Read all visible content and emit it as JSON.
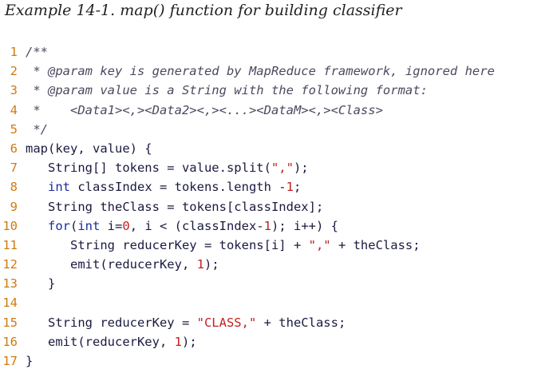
{
  "caption": "Example 14-1. map() function for building classifier",
  "lines": [
    {
      "n": "1",
      "parts": [
        {
          "t": "/**",
          "c": "cm"
        }
      ]
    },
    {
      "n": "2",
      "parts": [
        {
          "t": " * @param key is generated by MapReduce framework, ignored here",
          "c": "cm"
        }
      ]
    },
    {
      "n": "3",
      "parts": [
        {
          "t": " * @param value is a String with the following format:",
          "c": "cm"
        }
      ]
    },
    {
      "n": "4",
      "parts": [
        {
          "t": " *    <Data1><,><Data2><,><...><DataM><,><Class>",
          "c": "cm"
        }
      ]
    },
    {
      "n": "5",
      "parts": [
        {
          "t": " */",
          "c": "cm"
        }
      ]
    },
    {
      "n": "6",
      "parts": [
        {
          "t": "map(key, value) {",
          "c": "nm"
        }
      ]
    },
    {
      "n": "7",
      "parts": [
        {
          "t": "   String[] tokens = value.split(",
          "c": "nm"
        },
        {
          "t": "\",\"",
          "c": "str"
        },
        {
          "t": ");",
          "c": "nm"
        }
      ]
    },
    {
      "n": "8",
      "parts": [
        {
          "t": "   ",
          "c": "nm"
        },
        {
          "t": "int",
          "c": "kw"
        },
        {
          "t": " classIndex = tokens.length -",
          "c": "nm"
        },
        {
          "t": "1",
          "c": "num"
        },
        {
          "t": ";",
          "c": "nm"
        }
      ]
    },
    {
      "n": "9",
      "parts": [
        {
          "t": "   String theClass = tokens[classIndex];",
          "c": "nm"
        }
      ]
    },
    {
      "n": "10",
      "parts": [
        {
          "t": "   ",
          "c": "nm"
        },
        {
          "t": "for",
          "c": "kw"
        },
        {
          "t": "(",
          "c": "nm"
        },
        {
          "t": "int",
          "c": "kw"
        },
        {
          "t": " i=",
          "c": "nm"
        },
        {
          "t": "0",
          "c": "num"
        },
        {
          "t": ", i < (classIndex-",
          "c": "nm"
        },
        {
          "t": "1",
          "c": "num"
        },
        {
          "t": "); i++) {",
          "c": "nm"
        }
      ]
    },
    {
      "n": "11",
      "parts": [
        {
          "t": "      String reducerKey = tokens[i] + ",
          "c": "nm"
        },
        {
          "t": "\",\"",
          "c": "str"
        },
        {
          "t": " + theClass;",
          "c": "nm"
        }
      ]
    },
    {
      "n": "12",
      "parts": [
        {
          "t": "      emit(reducerKey, ",
          "c": "nm"
        },
        {
          "t": "1",
          "c": "num"
        },
        {
          "t": ");",
          "c": "nm"
        }
      ]
    },
    {
      "n": "13",
      "parts": [
        {
          "t": "   }",
          "c": "nm"
        }
      ]
    },
    {
      "n": "14",
      "parts": [
        {
          "t": "",
          "c": "nm"
        }
      ]
    },
    {
      "n": "15",
      "parts": [
        {
          "t": "   String reducerKey = ",
          "c": "nm"
        },
        {
          "t": "\"CLASS,\"",
          "c": "str"
        },
        {
          "t": " + theClass;",
          "c": "nm"
        }
      ]
    },
    {
      "n": "16",
      "parts": [
        {
          "t": "   emit(reducerKey, ",
          "c": "nm"
        },
        {
          "t": "1",
          "c": "num"
        },
        {
          "t": ");",
          "c": "nm"
        }
      ]
    },
    {
      "n": "17",
      "parts": [
        {
          "t": "}",
          "c": "nm"
        }
      ]
    }
  ]
}
